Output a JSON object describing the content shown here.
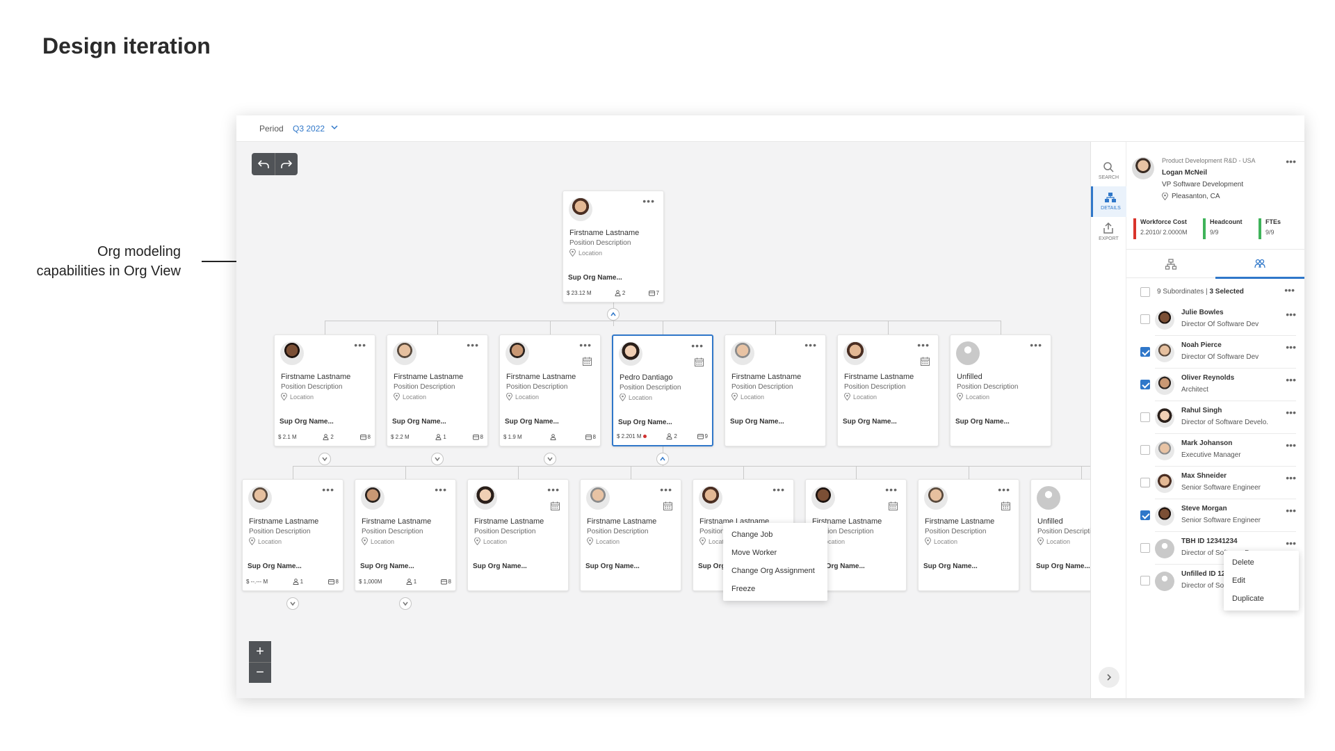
{
  "page": {
    "title": "Design iteration",
    "note_line1": "Org modeling",
    "note_line2": "capabilities in Org View"
  },
  "topbar": {
    "period_label": "Period",
    "period_value": "Q3 2022"
  },
  "cards": {
    "root": {
      "name": "Firstname Lastname",
      "position": "Position Description",
      "location": "Location",
      "sup_org": "Sup Org Name...",
      "cost": "$ 23.12 M",
      "headcount": "2",
      "ftes": "7"
    },
    "level1": [
      {
        "name": "Firstname Lastname",
        "position": "Position Description",
        "location": "Location",
        "sup_org": "Sup Org Name...",
        "cost": "$ 2.1 M",
        "headcount": "2",
        "ftes": "8"
      },
      {
        "name": "Firstname Lastname",
        "position": "Position Description",
        "location": "Location",
        "sup_org": "Sup Org Name...",
        "cost": "$ 2.2 M",
        "headcount": "1",
        "ftes": "8"
      },
      {
        "name": "Firstname Lastname",
        "position": "Position Description",
        "location": "Location",
        "sup_org": "Sup Org Name...",
        "cost": "$ 1.9 M",
        "headcount": "",
        "ftes": "8"
      },
      {
        "name": "Pedro Dantiago",
        "position": "Position Description",
        "location": "Location",
        "sup_org": "Sup Org Name...",
        "cost": "$ 2.201 M",
        "headcount": "2",
        "ftes": "9"
      },
      {
        "name": "Firstname Lastname",
        "position": "Position Description",
        "location": "Location",
        "sup_org": "Sup Org Name..."
      },
      {
        "name": "Firstname Lastname",
        "position": "Position Description",
        "location": "Location",
        "sup_org": "Sup Org Name..."
      },
      {
        "name": "Unfilled",
        "position": "Position Description",
        "location": "Location",
        "sup_org": "Sup Org Name..."
      }
    ],
    "level2": [
      {
        "name": "Firstname Lastname",
        "position": "Position Description",
        "location": "Location",
        "sup_org": "Sup Org Name...",
        "cost": "$ --.--- M",
        "headcount": "1",
        "ftes": "8"
      },
      {
        "name": "Firstname Lastname",
        "position": "Position Description",
        "location": "Location",
        "sup_org": "Sup Org Name...",
        "cost": "$ 1,000M",
        "headcount": "1",
        "ftes": "8"
      },
      {
        "name": "Firstname Lastname",
        "position": "Position Description",
        "location": "Location",
        "sup_org": "Sup Org Name..."
      },
      {
        "name": "Firstname Lastname",
        "position": "Position Description",
        "location": "Location",
        "sup_org": "Sup Org Name..."
      },
      {
        "name": "Firstname Lastname",
        "position": "Position Description",
        "location": "Location",
        "sup_org": "Sup Org Name..."
      },
      {
        "name": "Firstname Lastname",
        "position": "Position Description",
        "location": "Location",
        "sup_org": "Sup Org Name..."
      },
      {
        "name": "Firstname Lastname",
        "position": "Position Description",
        "location": "Location",
        "sup_org": "Sup Org Name..."
      },
      {
        "name": "Unfilled",
        "position": "Position Description",
        "location": "Location",
        "sup_org": "Sup Org Name..."
      }
    ]
  },
  "card_menu": {
    "items": [
      "Change Job",
      "Move Worker",
      "Change Org Assignment",
      "Freeze"
    ]
  },
  "toolrail": {
    "search": "SEARCH",
    "details": "DETAILS",
    "export": "EXPORT"
  },
  "panel": {
    "org": "Product Development R&D - USA",
    "name": "Logan McNeil",
    "title": "VP Software Development",
    "location": "Pleasanton, CA",
    "metrics": [
      {
        "label": "Workforce Cost",
        "value": "2.2010/ 2.0000M",
        "color": "#d9342b"
      },
      {
        "label": "Headcount",
        "value": "9/9",
        "color": "#3fb35a"
      },
      {
        "label": "FTEs",
        "value": "9/9",
        "color": "#3fb35a"
      }
    ],
    "subordinates_label": "9 Subordinates |",
    "selected_label": "3 Selected",
    "people": [
      {
        "name": "Julie Bowles",
        "title": "Director Of Software Dev",
        "checked": false
      },
      {
        "name": "Noah Pierce",
        "title": "Director Of Software Dev",
        "checked": true
      },
      {
        "name": "Oliver Reynolds",
        "title": "Architect",
        "checked": true
      },
      {
        "name": "Rahul Singh",
        "title": "Director of Software Develo.",
        "checked": false
      },
      {
        "name": "Mark Johanson",
        "title": "Executive Manager",
        "checked": false
      },
      {
        "name": "Max Shneider",
        "title": "Senior Software Engineer",
        "checked": false
      },
      {
        "name": "Steve Morgan",
        "title": "Senior Software Engineer",
        "checked": true
      },
      {
        "name": "TBH ID 12341234",
        "title": "Director of Software Dev",
        "checked": false
      },
      {
        "name": "Unfilled ID 12341234",
        "title": "Director of Software Dev",
        "checked": false
      }
    ],
    "row_menu": [
      "Delete",
      "Edit",
      "Duplicate"
    ]
  },
  "colors": {
    "accent": "#2f77c9",
    "dark_button": "#505357"
  }
}
